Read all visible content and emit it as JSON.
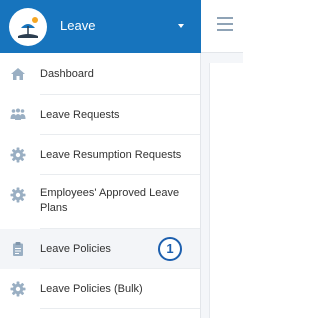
{
  "app": {
    "title": "Leave",
    "logo_icon": "beach-umbrella-logo-icon",
    "brand_color": "#1774bd"
  },
  "topbar": {
    "menu_icon": "hamburger-menu-icon"
  },
  "sidebar": {
    "items": [
      {
        "label": "Dashboard",
        "icon": "home-icon"
      },
      {
        "label": "Leave Requests",
        "icon": "users-icon"
      },
      {
        "label": "Leave Resumption Requests",
        "icon": "gear-icon"
      },
      {
        "label": "Employees' Approved Leave Plans",
        "icon": "gear-icon"
      },
      {
        "label": "Leave Policies",
        "icon": "clipboard-icon",
        "active": true,
        "badge": "1"
      },
      {
        "label": "Leave Policies (Bulk)",
        "icon": "gear-icon"
      }
    ]
  },
  "colors": {
    "icon": "#9aafc3",
    "badge": "#1d5fae",
    "active_bg": "#f3f5f8"
  }
}
